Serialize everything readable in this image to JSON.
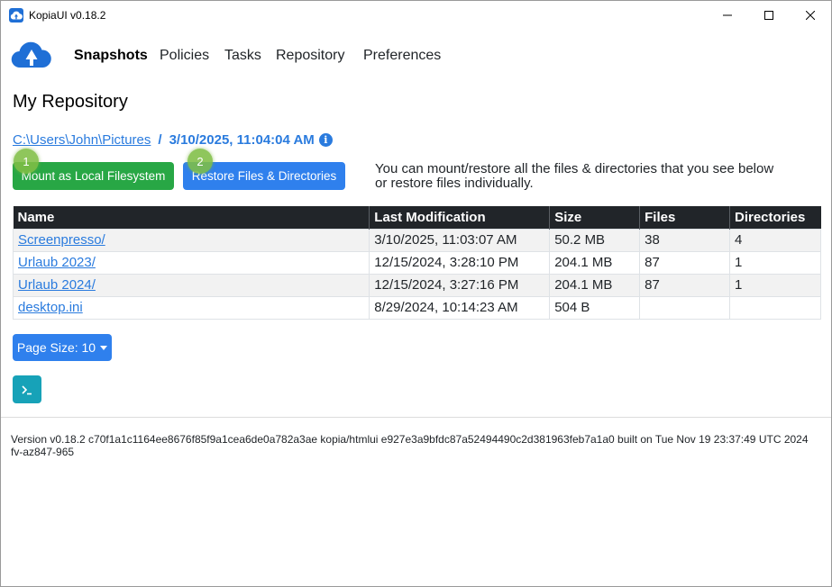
{
  "window": {
    "title": "KopiaUI v0.18.2"
  },
  "nav": {
    "items": [
      {
        "label": "Snapshots",
        "active": true
      },
      {
        "label": "Policies"
      },
      {
        "label": "Tasks"
      },
      {
        "label": "Repository"
      },
      {
        "label": "Preferences"
      }
    ]
  },
  "page": {
    "title": "My Repository"
  },
  "breadcrumb": {
    "path": "C:\\Users\\John\\Pictures",
    "separator": "/",
    "timestamp": "3/10/2025, 11:04:04 AM",
    "info_glyph": "i"
  },
  "actions": {
    "mount_label": "Mount as Local Filesystem",
    "restore_label": "Restore Files & Directories",
    "step1": "1",
    "step2": "2",
    "help_text": "You can mount/restore all the files & directories that you see below or restore files individually."
  },
  "table": {
    "columns": [
      "Name",
      "Last Modification",
      "Size",
      "Files",
      "Directories"
    ],
    "rows": [
      {
        "name": "Screenpresso/",
        "modified": "3/10/2025, 11:03:07 AM",
        "size": "50.2 MB",
        "files": "38",
        "dirs": "4"
      },
      {
        "name": "Urlaub 2023/",
        "modified": "12/15/2024, 3:28:10 PM",
        "size": "204.1 MB",
        "files": "87",
        "dirs": "1"
      },
      {
        "name": "Urlaub 2024/",
        "modified": "12/15/2024, 3:27:16 PM",
        "size": "204.1 MB",
        "files": "87",
        "dirs": "1"
      },
      {
        "name": "desktop.ini",
        "modified": "8/29/2024, 10:14:23 AM",
        "size": "504 B",
        "files": "",
        "dirs": ""
      }
    ]
  },
  "pagination": {
    "page_size_label": "Page Size: 10"
  },
  "terminal": {
    "glyph": ">_"
  },
  "footer": {
    "version": "Version v0.18.2 c70f1a1c1164ee8676f85f9a1cea6de0a782a3ae kopia/htmlui e927e3a9bfdc87a52494490c2d381963feb7a1a0 built on Tue Nov 19 23:37:49 UTC 2024 fv-az847-965"
  },
  "colors": {
    "primary": "#2f80ed",
    "success": "#28a745",
    "info": "#17a2b8",
    "table_header": "#212529",
    "link": "#2a7bde"
  },
  "icons": [
    "kopia-app-icon",
    "kopia-cloud-logo",
    "minimize-icon",
    "maximize-icon",
    "close-icon",
    "info-icon",
    "terminal-icon",
    "chevron-down-icon"
  ]
}
